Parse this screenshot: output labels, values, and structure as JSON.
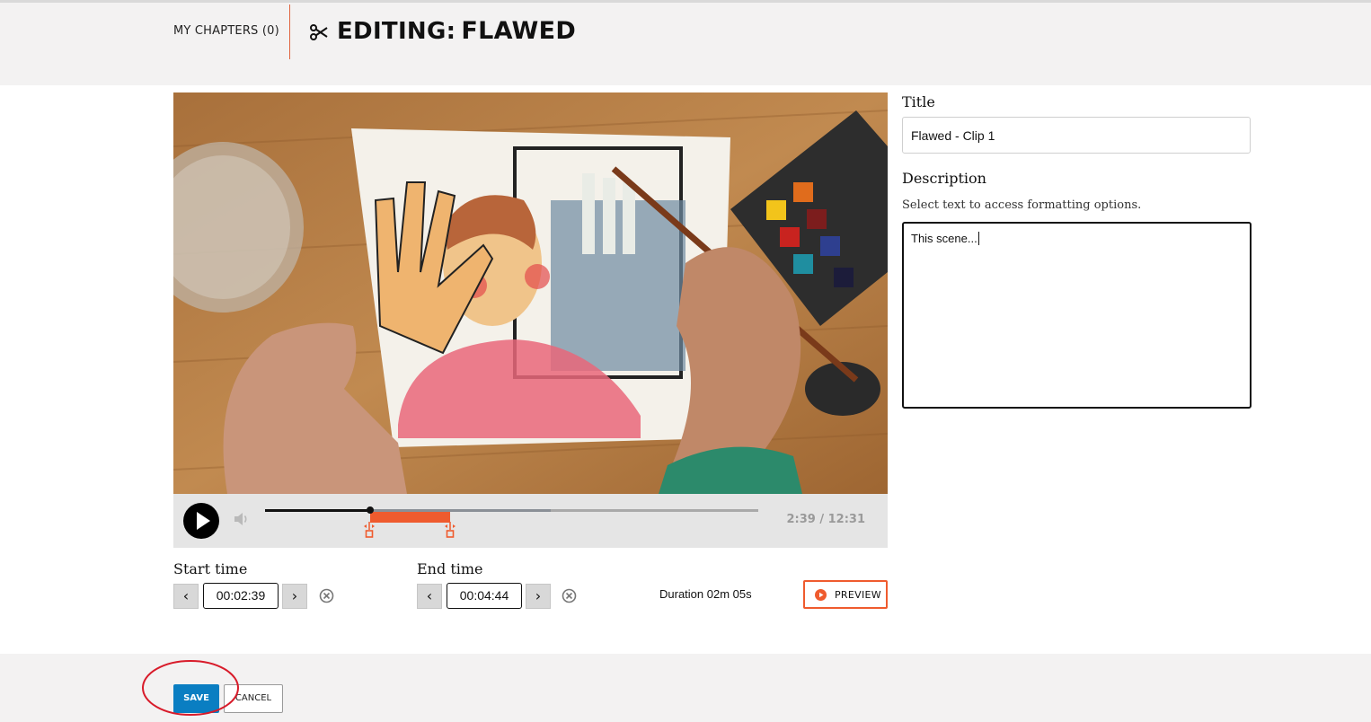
{
  "header": {
    "chapters_label": "MY CHAPTERS (0)",
    "editing_label": "EDITING:",
    "title": "FLAWED",
    "scissors_icon": "scissors-icon"
  },
  "player": {
    "timecode": "2:39 / 12:31",
    "progress_fraction": 0.2117,
    "selection_start_fraction": 0.2117,
    "selection_end_fraction": 0.3781,
    "buffered_fraction": 0.5783
  },
  "form": {
    "title_label": "Title",
    "title_value": "Flawed - Clip 1",
    "description_label": "Description",
    "description_hint": "Select text to access formatting options.",
    "description_value": "This scene..."
  },
  "clip": {
    "start_label": "Start time",
    "start_value": "00:02:39",
    "end_label": "End time",
    "end_value": "00:04:44",
    "prev_glyph": "‹",
    "next_glyph": "›",
    "duration": "Duration 02m 05s",
    "preview_label": "PREVIEW"
  },
  "footer": {
    "save_label": "SAVE",
    "cancel_label": "CANCEL"
  },
  "colors": {
    "accent": "#ef5b2e",
    "primary": "#0a7ec2",
    "annotation_circle": "#d81b2a"
  }
}
